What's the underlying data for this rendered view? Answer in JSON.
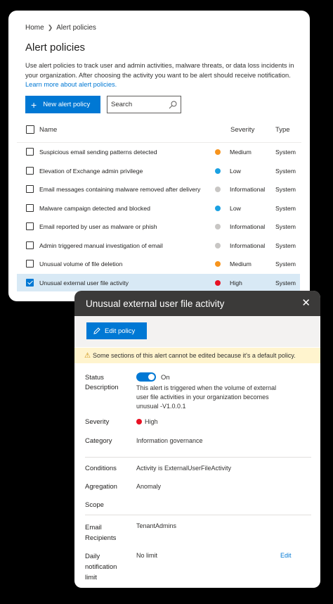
{
  "breadcrumb": {
    "home": "Home",
    "current": "Alert policies"
  },
  "page": {
    "title": "Alert policies",
    "description": "Use alert policies to track user and admin activities, malware threats, or data loss incidents in your organization. After choosing the activity you want to be alert should receive notification.",
    "learn_more": "Learn more about alert policies."
  },
  "toolbar": {
    "new_label": "New alert policy",
    "search_placeholder": "Search"
  },
  "table": {
    "columns": {
      "name": "Name",
      "severity": "Severity",
      "type": "Type"
    },
    "rows": [
      {
        "name": "Suspicious email sending patterns detected",
        "severity": "Medium",
        "type": "System",
        "color": "#f7941d"
      },
      {
        "name": "Elevation of Exchange admin privilege",
        "severity": "Low",
        "type": "System",
        "color": "#1ba1e2"
      },
      {
        "name": "Email messages containing malware removed after delivery",
        "severity": "Informational",
        "type": "System",
        "color": "#c8c6c4"
      },
      {
        "name": "Malware campaign detected and blocked",
        "severity": "Low",
        "type": "System",
        "color": "#1ba1e2"
      },
      {
        "name": "Email reported by user as malware or phish",
        "severity": "Informational",
        "type": "System",
        "color": "#c8c6c4"
      },
      {
        "name": "Admin triggered manual investigation of email",
        "severity": "Informational",
        "type": "System",
        "color": "#c8c6c4"
      },
      {
        "name": "Unusual volume of file deletion",
        "severity": "Medium",
        "type": "System",
        "color": "#f7941d"
      },
      {
        "name": "Unusual external user file activity",
        "severity": "High",
        "type": "System",
        "color": "#e81123",
        "selected": true
      }
    ]
  },
  "panel": {
    "title": "Unusual external user file activity",
    "edit_label": "Edit policy",
    "warning": "Some sections of this alert cannot be edited because it's a default policy.",
    "status_label": "Status",
    "status_value": "On",
    "description_label": "Description",
    "description_value": "This alert is triggered when the volume of external user file activities in your organization becomes unusual -V1.0.0.1",
    "severity_label": "Severity",
    "severity_value": "High",
    "severity_color": "#e81123",
    "category_label": "Category",
    "category_value": "Information governance",
    "conditions_label": "Conditions",
    "conditions_value": "Activity is ExternalUserFileActivity",
    "aggregation_label": "Agregation",
    "aggregation_value": "Anomaly",
    "scope_label": "Scope",
    "recipients_label": "Email Recipients",
    "recipients_value": "TenantAdmins",
    "limit_label": "Daily notification limit",
    "limit_value": "No limit",
    "limit_edit": "Edit"
  }
}
